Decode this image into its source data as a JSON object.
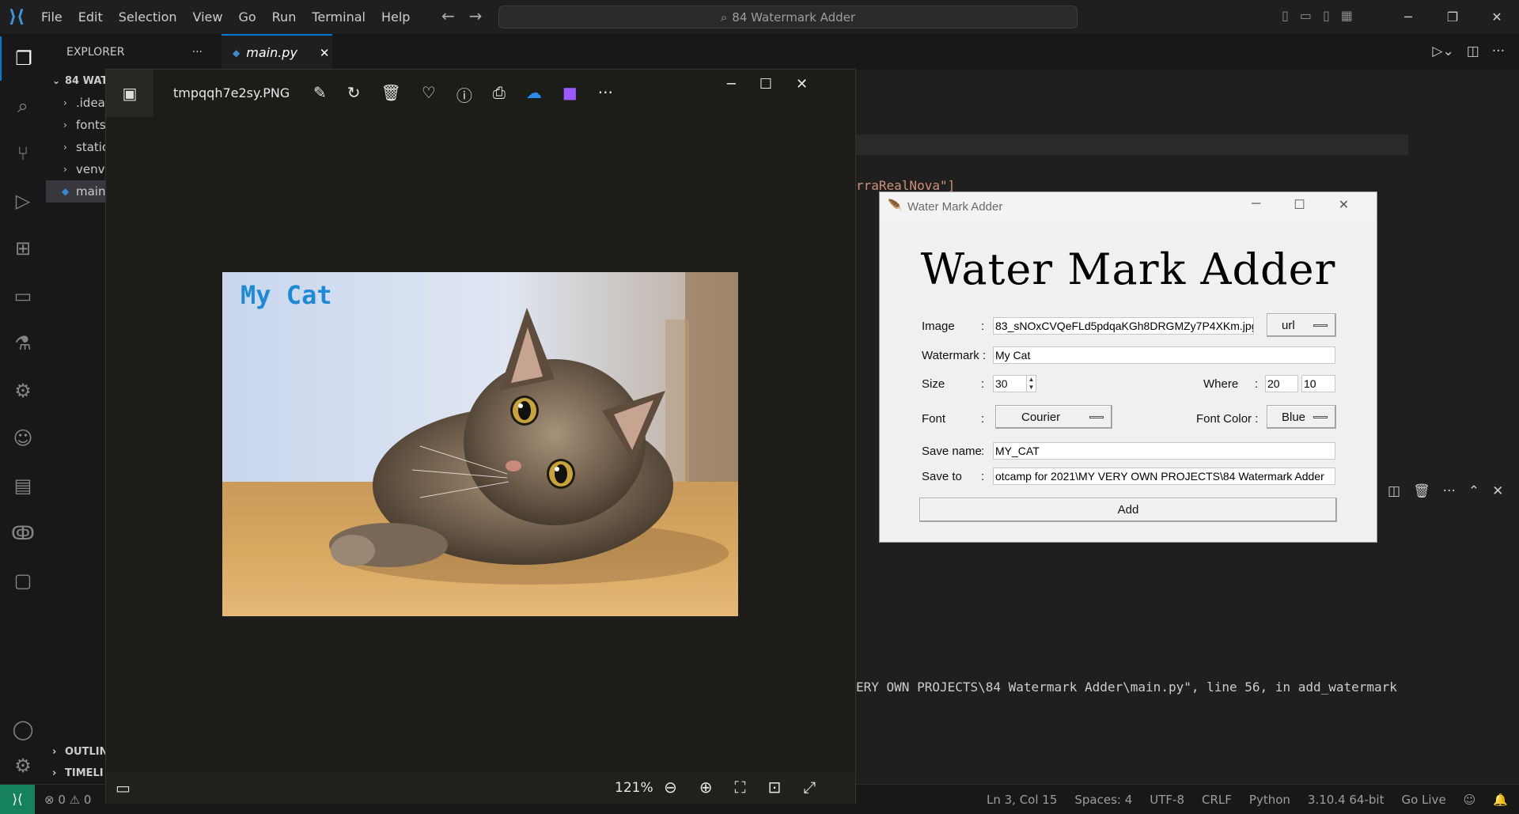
{
  "vscode": {
    "menu": [
      "File",
      "Edit",
      "Selection",
      "View",
      "Go",
      "Run",
      "Terminal",
      "Help"
    ],
    "search_text": "84 Watermark Adder",
    "explorer_title": "EXPLORER",
    "project_label": "84 WAT",
    "tree": [
      ".idea",
      "fonts",
      "static",
      "venv",
      "main"
    ],
    "outline_label": "OUTLIN",
    "timeline_label": "TIMELI",
    "tab_label": "main.py",
    "code_fragment": "rraRealNova\"]",
    "terminal_fragment": "ERY OWN PROJECTS\\84 Watermark Adder\\main.py\", line 56, in add_watermark",
    "status": {
      "problems": "⊗ 0 ⚠ 0",
      "position": "Ln 3, Col 15",
      "spaces": "Spaces: 4",
      "encoding": "UTF-8",
      "eol": "CRLF",
      "language": "Python",
      "interpreter": "3.10.4 64-bit",
      "golive": "Go Live"
    }
  },
  "photos": {
    "file_name": "tmpqqh7e2sy.PNG",
    "watermark_text": "My Cat",
    "zoom": "121%",
    "watermark_color": "#1e8ad6"
  },
  "tk": {
    "window_title": "Water Mark Adder",
    "heading": "Water Mark Adder",
    "image_label": "Image",
    "image_value": "83_sNOxCVQeFLd5pdqaKGh8DRGMZy7P4XKm.jpg",
    "source_option": "url",
    "watermark_label": "Watermark :",
    "watermark_value": "My Cat",
    "size_label": "Size",
    "size_value": "30",
    "where_label": "Where",
    "where_x": "20",
    "where_y": "10",
    "font_label": "Font",
    "font_value": "Courier",
    "font_color_label": "Font Color :",
    "font_color_value": "Blue",
    "save_name_label": "Save name",
    "save_name_value": "MY_CAT",
    "save_to_label": "Save to",
    "save_to_value": "otcamp for 2021\\MY VERY OWN PROJECTS\\84 Watermark Adder",
    "colon": ":",
    "add_button": "Add"
  }
}
